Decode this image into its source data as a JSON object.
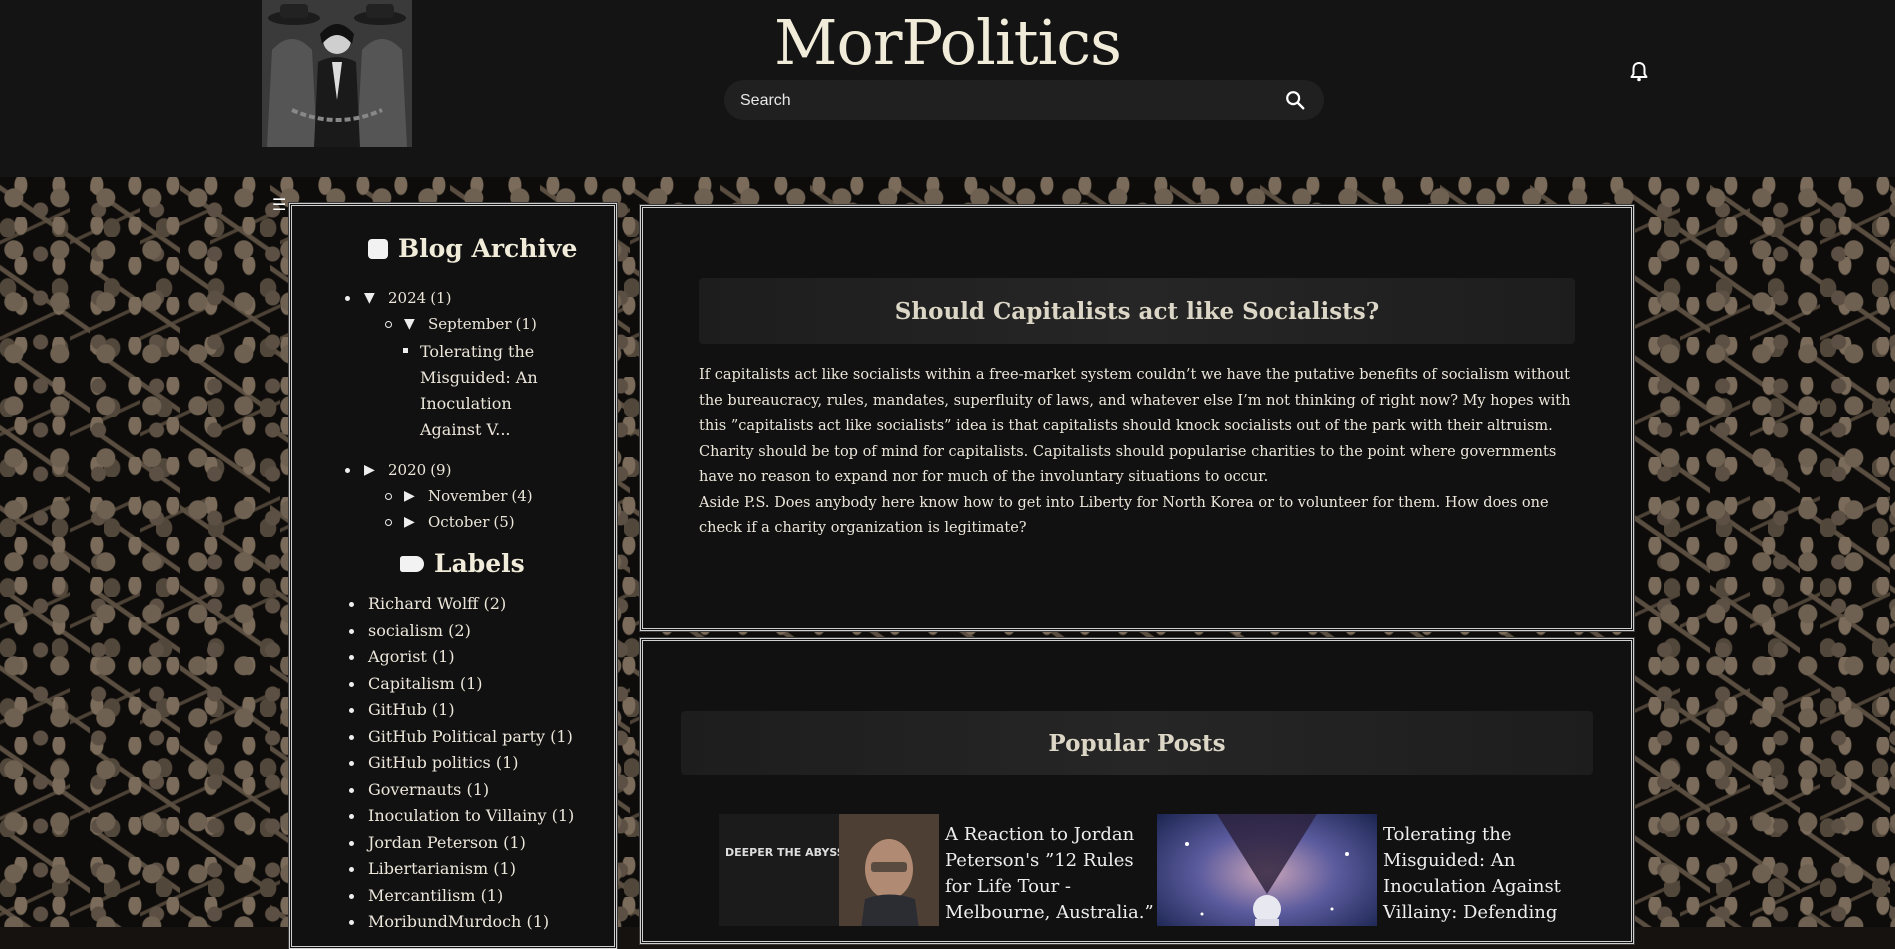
{
  "header": {
    "site_title": "MorPolitics",
    "search_placeholder": "Search"
  },
  "sidebar": {
    "archive_title": "Blog Archive",
    "archive": [
      {
        "year": "2024",
        "count": "(1)",
        "expanded": true,
        "months": [
          {
            "month": "September",
            "count": "(1)",
            "expanded": true,
            "posts": [
              "Tolerating the Misguided: An Inoculation Against V..."
            ]
          }
        ]
      },
      {
        "year": "2020",
        "count": "(9)",
        "expanded": false,
        "months": [
          {
            "month": "November",
            "count": "(4)",
            "expanded": false
          },
          {
            "month": "October",
            "count": "(5)",
            "expanded": false
          }
        ]
      }
    ],
    "labels_title": "Labels",
    "labels": [
      {
        "name": "Richard Wolff",
        "count": "(2)"
      },
      {
        "name": "socialism",
        "count": "(2)"
      },
      {
        "name": "Agorist",
        "count": "(1)"
      },
      {
        "name": "Capitalism",
        "count": "(1)"
      },
      {
        "name": "GitHub",
        "count": "(1)"
      },
      {
        "name": "GitHub Political party",
        "count": "(1)"
      },
      {
        "name": "GitHub politics",
        "count": "(1)"
      },
      {
        "name": "Governauts",
        "count": "(1)"
      },
      {
        "name": "Inoculation to Villainy",
        "count": "(1)"
      },
      {
        "name": "Jordan Peterson",
        "count": "(1)"
      },
      {
        "name": "Libertarianism",
        "count": "(1)"
      },
      {
        "name": "Mercantilism",
        "count": "(1)"
      },
      {
        "name": "MoribundMurdoch",
        "count": "(1)"
      }
    ]
  },
  "post": {
    "title": "Should Capitalists act like Socialists?",
    "paragraph1": "If capitalists act like socialists within a free-market system couldn’t we have the putative benefits of socialism without the bureaucracy, rules, mandates, superfluity of laws, and whatever else I’m not thinking of right now? My hopes with this ”capitalists act like socialists” idea is that capitalists should knock socialists out of the park with their altruism. Charity should be top of mind for capitalists. Capitalists should popularise charities to the point where governments have no reason to expand nor for much of the involuntary situations to occur.",
    "paragraph2": "Aside P.S. Does anybody here know how to get into Liberty for North Korea or to volunteer for them. How does one check if a charity organization is legitimate?"
  },
  "popular": {
    "title": "Popular Posts",
    "items": [
      {
        "title": "A Reaction to Jordan Peterson's ”12 Rules for Life Tour - Melbourne, Australia.” YouTube Video",
        "thumb_text": "DEEPER THE ABYSS, BRIGHTER THE LIGHT"
      },
      {
        "title": "Tolerating the Misguided: An Inoculation Against Villainy: Defending Odysee"
      }
    ]
  }
}
